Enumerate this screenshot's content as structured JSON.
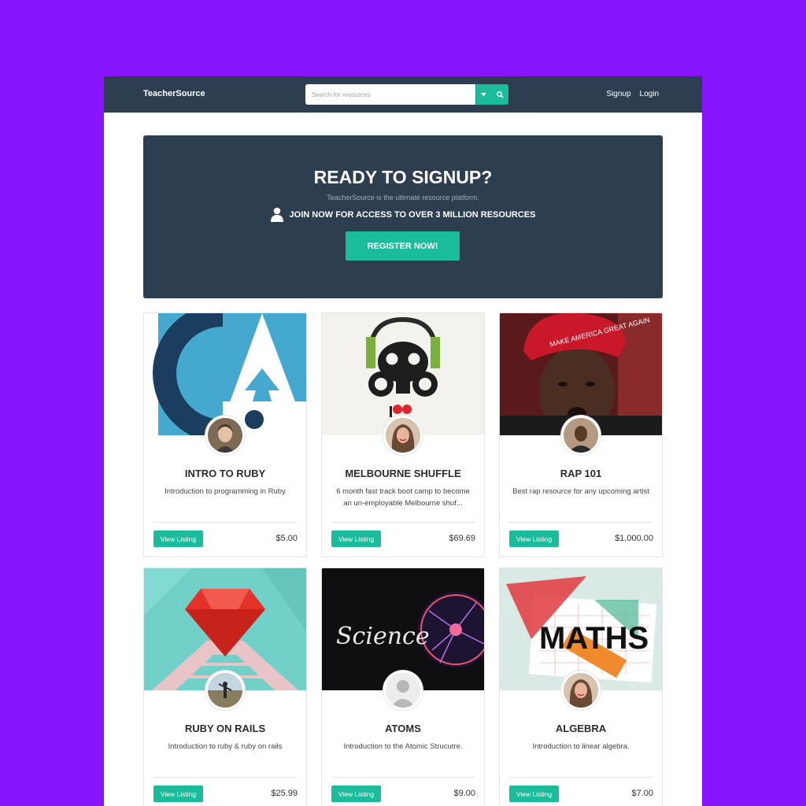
{
  "navbar": {
    "brand": "TeacherSource",
    "search_placeholder": "Search for resources",
    "links": [
      "Signup",
      "Login"
    ]
  },
  "hero": {
    "title": "READY TO SIGNUP?",
    "subtitle": "TeacherSource is the ultimate resource platform.",
    "cta_line": "JOIN NOW FOR ACCESS TO OVER 3 MILLION RESOURCES",
    "button": "REGISTER NOW!"
  },
  "listings": [
    {
      "title": "INTRO TO RUBY",
      "description": "Introduction to programming in Ruby",
      "price": "$5.00",
      "button": "View Listing"
    },
    {
      "title": "MELBOURNE SHUFFLE",
      "description": "6 month fast track boot camp to become an un-employable Melbourne shuf...",
      "price": "$69.69",
      "button": "View Listing"
    },
    {
      "title": "RAP 101",
      "description": "Best rap resource for any upcoming artist",
      "price": "$1,000.00",
      "button": "View Listing"
    },
    {
      "title": "RUBY ON RAILS",
      "description": "Introduction to ruby & ruby on rails",
      "price": "$25.99",
      "button": "View Listing"
    },
    {
      "title": "ATOMS",
      "description": "Introduction to the Atomic Strucutre.",
      "price": "$9.00",
      "button": "View Listing"
    },
    {
      "title": "ALGEBRA",
      "description": "Introduction to linear algebra.",
      "price": "$7.00",
      "button": "View Listing"
    }
  ],
  "images": {
    "science_label": "Science",
    "maths_label": "MATHS",
    "hat_text": "MAKE AMERICA GREAT AGAIN"
  },
  "colors": {
    "page_bg": "#8714fc",
    "navbar_bg": "#2c3e50",
    "accent": "#1abc9c"
  }
}
